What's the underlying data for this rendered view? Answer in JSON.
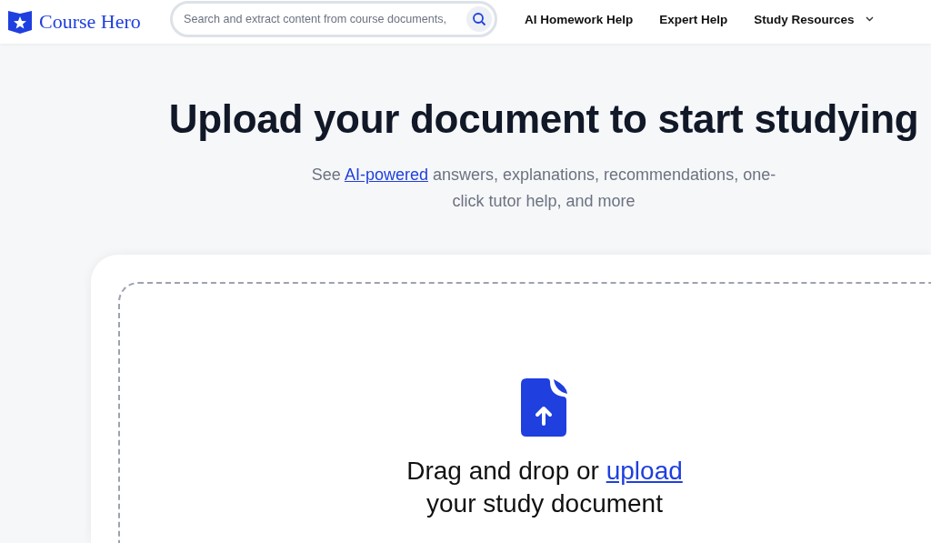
{
  "header": {
    "logo": "Course Hero",
    "search": {
      "placeholder": "Search and extract content from course documents,"
    },
    "nav": [
      {
        "label": "AI Homework Help",
        "kind": "link"
      },
      {
        "label": "Expert Help",
        "kind": "link"
      },
      {
        "label": "Study Resources",
        "kind": "dropdown"
      }
    ]
  },
  "hero": {
    "title": "Upload your document to start studying",
    "subtitle": [
      "See ",
      "AI-powered",
      " answers, explanations, recommendations, one-click tutor help, and more"
    ]
  },
  "upload": {
    "prompt": "Drag and drop or ",
    "link": "upload",
    "rest": "your study document"
  }
}
